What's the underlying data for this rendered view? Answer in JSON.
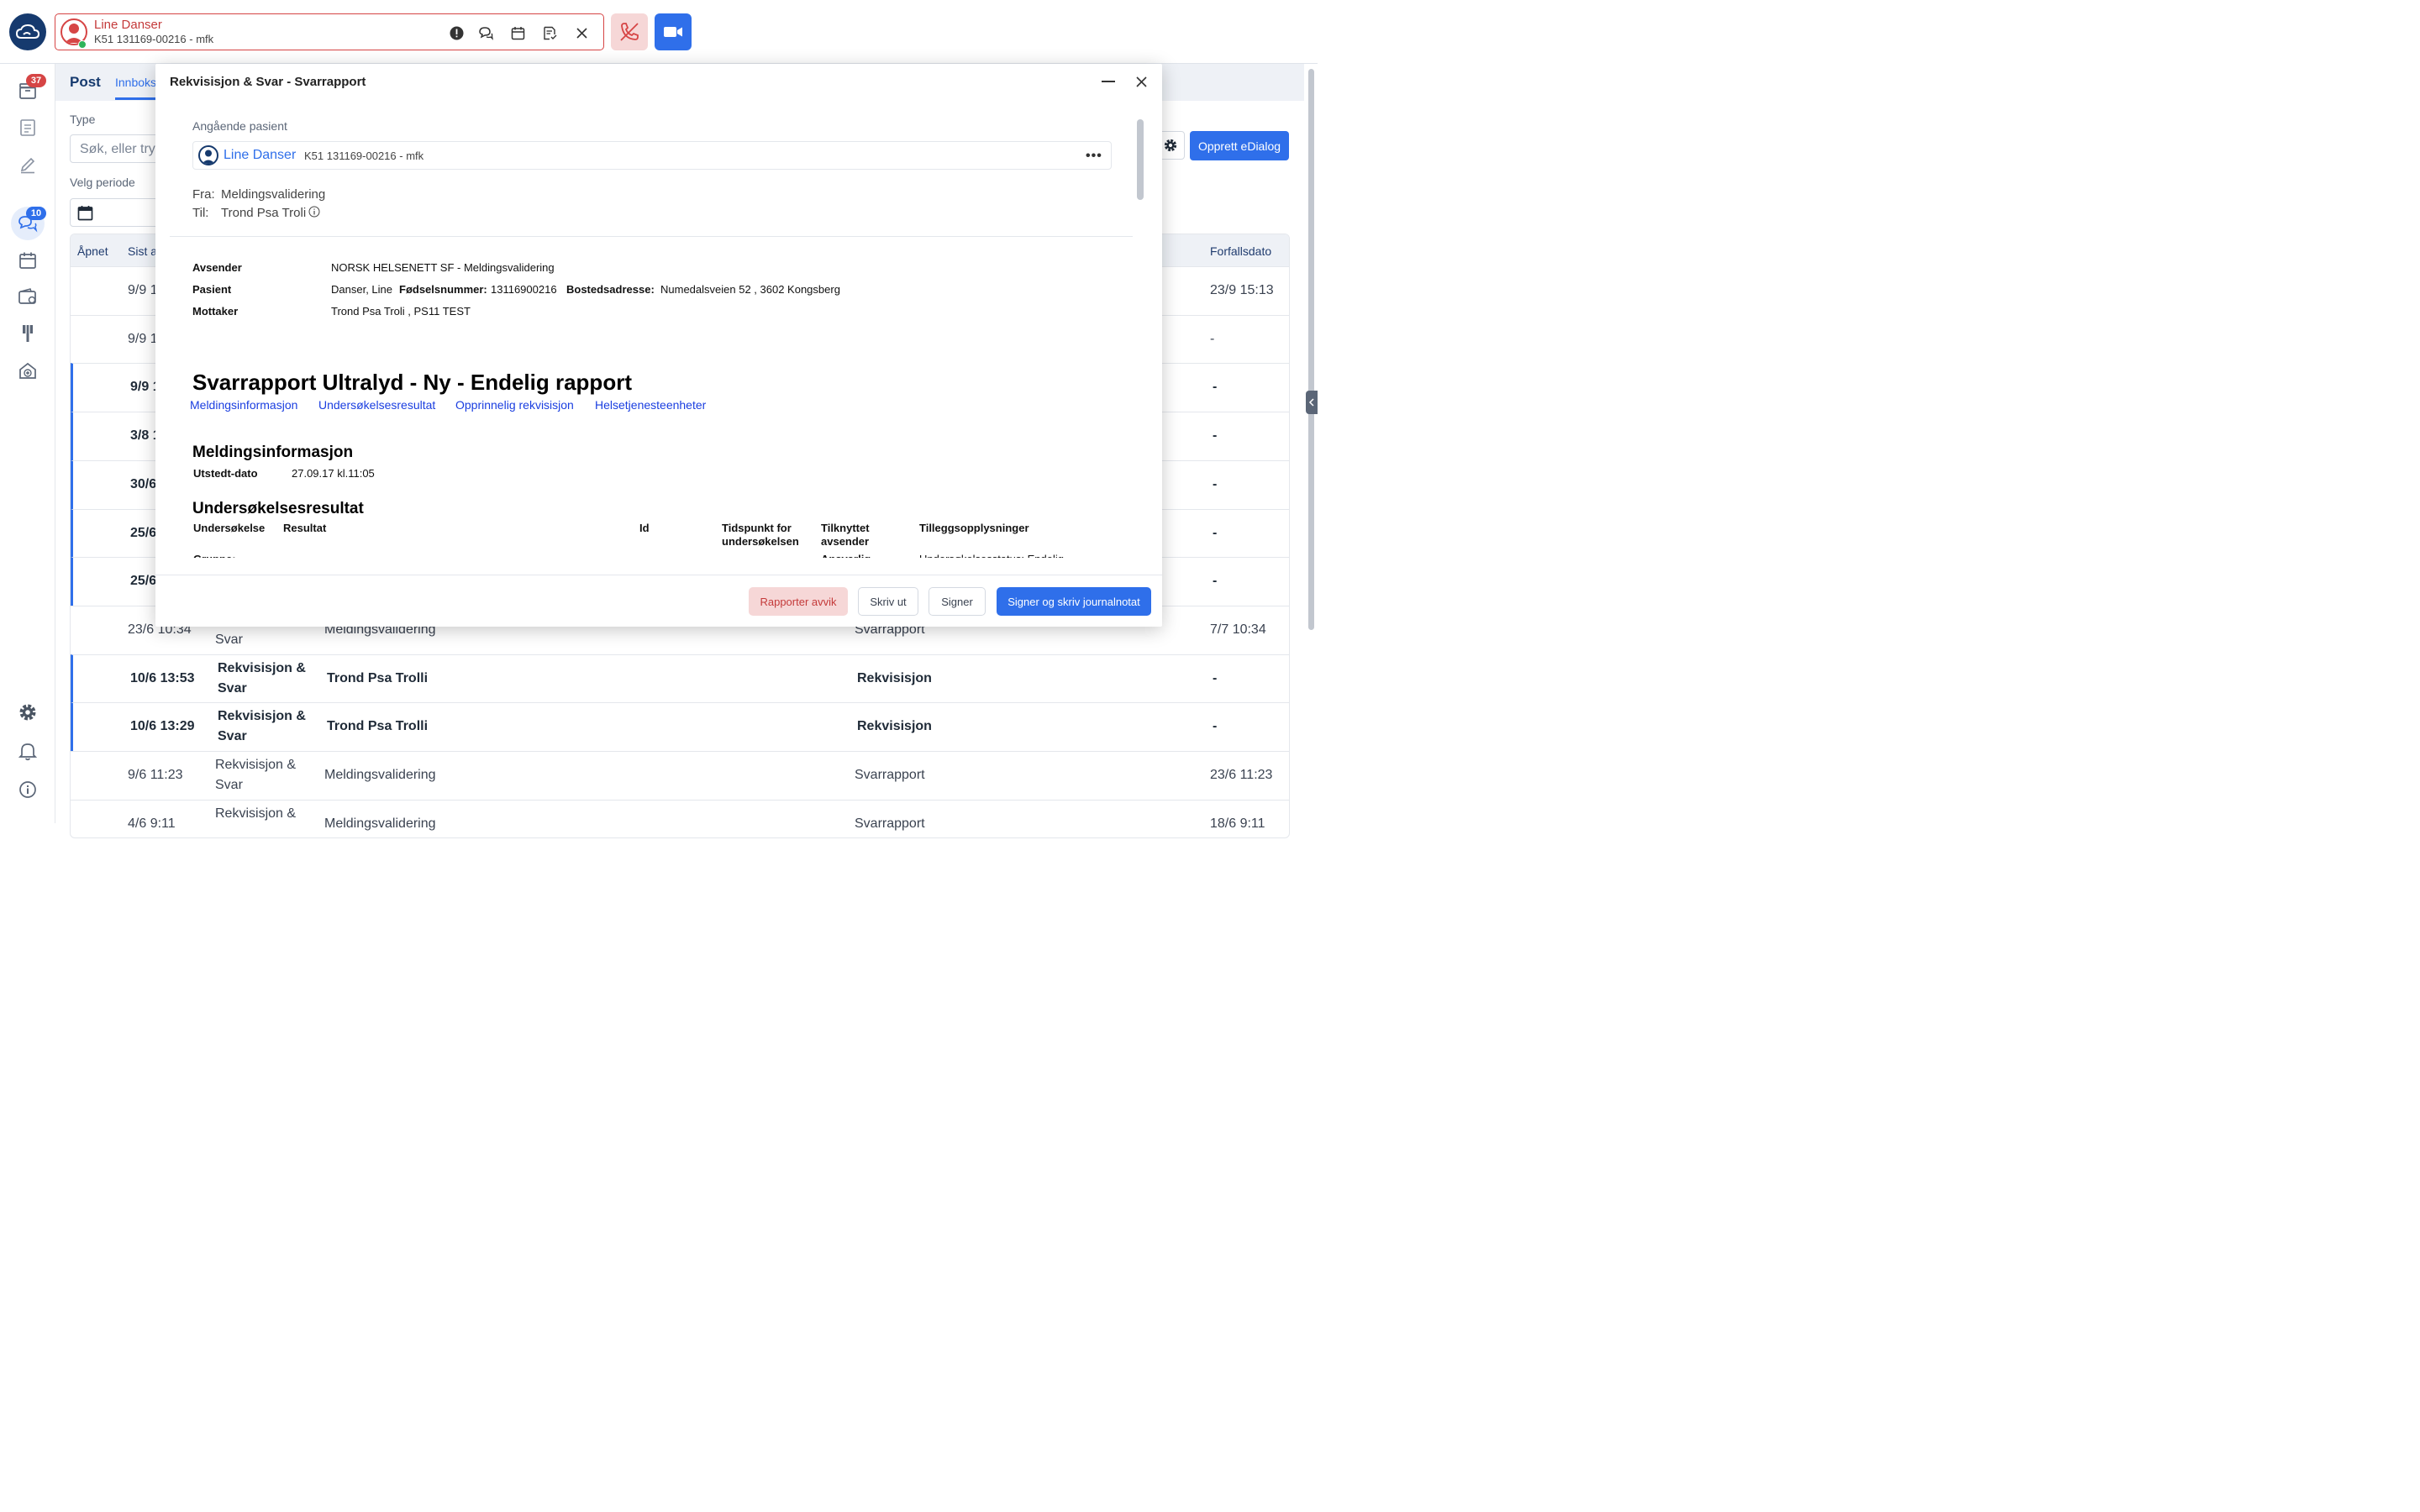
{
  "topbar": {
    "patient_name": "Line Danser",
    "patient_id": "K51 131169-00216 - mfk",
    "accent": "#d64545",
    "icons": [
      "alert-icon",
      "chat-icon",
      "calendar-icon",
      "document-icon",
      "close-icon"
    ]
  },
  "sidebar": {
    "inbox_badge": "37",
    "chat_badge": "10",
    "badge_red": "#d64545",
    "badge_blue": "#2f6fea"
  },
  "main": {
    "tab_post": "Post",
    "tab_innboks": "Innboks",
    "type_label": "Type",
    "search_placeholder": "Søk, eller try",
    "period_label": "Velg periode",
    "create_button": "Opprett eDialog",
    "columns": [
      "Åpnet",
      "Sist a",
      "Forfallsdato"
    ],
    "rows": [
      {
        "date": "9/9 1",
        "type": "",
        "from": "",
        "kind": "",
        "due": "23/9 15:13",
        "unread": false
      },
      {
        "date": "9/9 1",
        "type": "",
        "from": "",
        "kind": "",
        "due": "-",
        "unread": false
      },
      {
        "date": "9/9 1",
        "type": "",
        "from": "",
        "kind": "",
        "due": "-",
        "unread": true
      },
      {
        "date": "3/8 1",
        "type": "",
        "from": "",
        "kind": "",
        "due": "-",
        "unread": true
      },
      {
        "date": "30/6",
        "type": "",
        "from": "",
        "kind": "",
        "due": "-",
        "unread": true
      },
      {
        "date": "25/6",
        "type": "",
        "from": "",
        "kind": "",
        "due": "-",
        "unread": true
      },
      {
        "date": "25/6",
        "type": "",
        "from": "",
        "kind": "",
        "due": "-",
        "unread": true
      },
      {
        "date": "23/6 10:34",
        "type": "Svar",
        "from": "Meldingsvalidering",
        "kind": "Svarrapport",
        "due": "7/7 10:34",
        "unread": false
      },
      {
        "date": "10/6 13:53",
        "type": "Rekvisisjon & Svar",
        "from": "Trond Psa Trolli",
        "kind": "Rekvisisjon",
        "due": "-",
        "unread": true
      },
      {
        "date": "10/6 13:29",
        "type": "Rekvisisjon & Svar",
        "from": "Trond Psa Trolli",
        "kind": "Rekvisisjon",
        "due": "-",
        "unread": true
      },
      {
        "date": "9/6 11:23",
        "type": "Rekvisisjon & Svar",
        "from": "Meldingsvalidering",
        "kind": "Svarrapport",
        "due": "23/6 11:23",
        "unread": false
      },
      {
        "date": "4/6 9:11",
        "type": "Rekvisisjon &",
        "from": "Meldingsvalidering",
        "kind": "Svarrapport",
        "due": "18/6 9:11",
        "unread": false
      }
    ]
  },
  "modal": {
    "title": "Rekvisisjon & Svar - Svarrapport",
    "angaende_label": "Angående pasient",
    "patient_name": "Line Danser",
    "patient_id": "K51 131169-00216 - mfk",
    "fra_label": "Fra:",
    "fra_value": "Meldingsvalidering",
    "til_label": "Til:",
    "til_value": "Trond Psa Troli",
    "avsender_label": "Avsender",
    "avsender_value": "NORSK HELSENETT SF - Meldingsvalidering",
    "pasient_label": "Pasient",
    "pasient_name": "Danser, Line",
    "fnr_label": "Fødselsnummer:",
    "fnr_value": "13116900216",
    "adr_label": "Bostedsadresse:",
    "adr_value": "Numedalsveien 52 , 3602 Kongsberg",
    "mottaker_label": "Mottaker",
    "mottaker_value": "Trond Psa Troli ,  PS11 TEST",
    "doc_title": "Svarrapport Ultralyd - Ny - Endelig rapport",
    "links": [
      "Meldingsinformasjon",
      "Undersøkelsesresultat",
      "Opprinnelig rekvisisjon",
      "Helsetjenesteenheter"
    ],
    "section1": "Meldingsinformasjon",
    "utstedt_label": "Utstedt-dato",
    "utstedt_value": "27.09.17 kl.11:05",
    "section2": "Undersøkelsesresultat",
    "result_headers": [
      "Undersøkelse",
      "Resultat",
      "Id",
      "Tidspunkt for undersøkelsen",
      "Tilknyttet avsender",
      "Tilleggsopplysninger"
    ],
    "cut_row": [
      "Gruppe:",
      "Ansvarlig",
      "Undersøkelsesstatus: Endelig"
    ],
    "btn_avvik": "Rapporter avvik",
    "btn_print": "Skriv ut",
    "btn_sign": "Signer",
    "btn_sign_note": "Signer og skriv journalnotat"
  }
}
